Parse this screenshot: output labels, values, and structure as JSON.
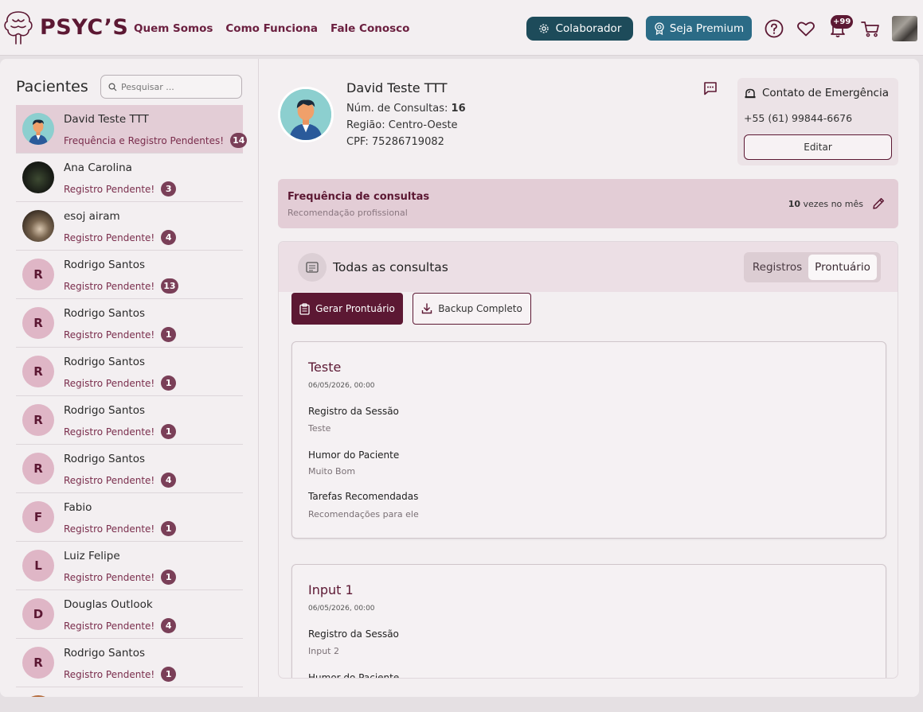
{
  "header": {
    "brand": "PSYC’S",
    "nav": [
      "Quem Somos",
      "Como Funciona",
      "Fale Conosco"
    ],
    "colaborador_label": "Colaborador",
    "premium_label": "Seja Premium",
    "notifications_count": "+99",
    "icons": [
      "help-icon",
      "heart-icon",
      "bell-icon",
      "cart-icon"
    ]
  },
  "sidebar": {
    "title": "Pacientes",
    "search_placeholder": "Pesquisar ...",
    "patients": [
      {
        "name": "David Teste TTT",
        "initial": "",
        "status": "Frequência e Registro Pendentes!",
        "count": "14"
      },
      {
        "name": "Ana Carolina",
        "initial": "",
        "status": "Registro Pendente!",
        "count": "3"
      },
      {
        "name": "esoj airam",
        "initial": "",
        "status": "Registro Pendente!",
        "count": "4"
      },
      {
        "name": "Rodrigo Santos",
        "initial": "R",
        "status": "Registro Pendente!",
        "count": "13"
      },
      {
        "name": "Rodrigo Santos",
        "initial": "R",
        "status": "Registro Pendente!",
        "count": "1"
      },
      {
        "name": "Rodrigo Santos",
        "initial": "R",
        "status": "Registro Pendente!",
        "count": "1"
      },
      {
        "name": "Rodrigo Santos",
        "initial": "R",
        "status": "Registro Pendente!",
        "count": "1"
      },
      {
        "name": "Rodrigo Santos",
        "initial": "R",
        "status": "Registro Pendente!",
        "count": "4"
      },
      {
        "name": "Fabio",
        "initial": "F",
        "status": "Registro Pendente!",
        "count": "1"
      },
      {
        "name": "Luiz Felipe",
        "initial": "L",
        "status": "Registro Pendente!",
        "count": "1"
      },
      {
        "name": "Douglas Outlook",
        "initial": "D",
        "status": "Registro Pendente!",
        "count": "4"
      },
      {
        "name": "Rodrigo Santos",
        "initial": "R",
        "status": "Registro Pendente!",
        "count": "1"
      }
    ]
  },
  "patient": {
    "name": "David Teste TTT",
    "consultas_label": "Núm. de Consultas: ",
    "consultas_value": "16",
    "regiao": "Região: Centro-Oeste",
    "cpf": "CPF: 75286719082"
  },
  "emergency": {
    "title": "Contato de Emergência",
    "phone": "+55 (61) 99844-6676",
    "edit_label": "Editar"
  },
  "frequency": {
    "title": "Frequência de consultas",
    "subtitle": "Recomendação profissional",
    "value": "10",
    "unit": "vezes no mês"
  },
  "consultations": {
    "title": "Todas as consultas",
    "tabs": [
      "Registros",
      "Prontuário"
    ],
    "gerar_label": "Gerar Prontuário",
    "backup_label": "Backup Completo",
    "cards": [
      {
        "title": "Teste",
        "date": "06/05/2026, 00:00",
        "fields": [
          {
            "label": "Registro da Sessão",
            "value": "Teste"
          },
          {
            "label": "Humor do Paciente",
            "value": "Muito Bom"
          },
          {
            "label": "Tarefas Recomendadas",
            "value": "Recomendações para ele"
          }
        ]
      },
      {
        "title": "Input 1",
        "date": "06/05/2026, 00:00",
        "fields": [
          {
            "label": "Registro da Sessão",
            "value": "Input 2"
          },
          {
            "label": "Humor do Paciente",
            "value": ""
          }
        ]
      }
    ]
  },
  "colors": {
    "brand": "#5c1833",
    "teal": "#1d4b5a",
    "premium": "#2b6b86",
    "highlight": "#e3cdd6"
  }
}
